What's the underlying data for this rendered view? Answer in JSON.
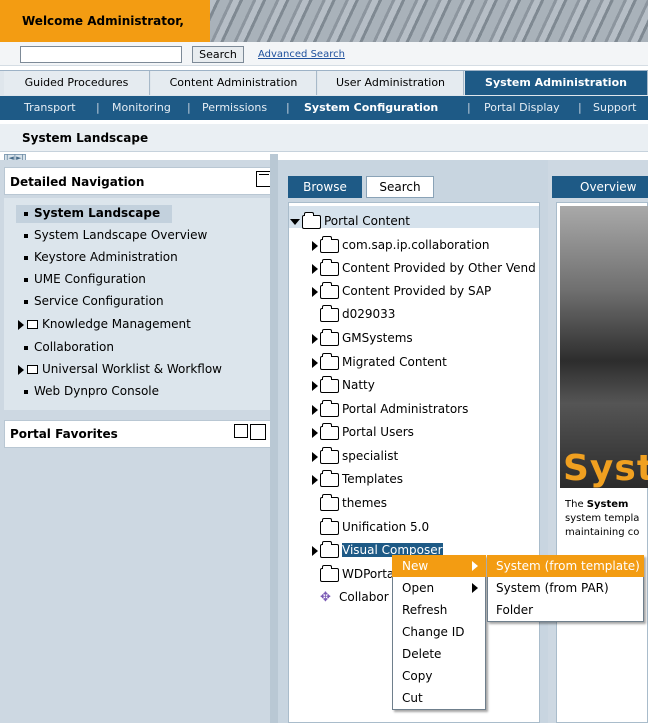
{
  "banner": {
    "welcome": "Welcome Administrator,"
  },
  "search": {
    "placeholder": "",
    "button": "Search",
    "advanced": "Advanced Search"
  },
  "top_tabs": [
    "Guided Procedures",
    "Content Administration",
    "User Administration",
    "System Administration"
  ],
  "sub_nav": [
    "Transport",
    "Monitoring",
    "Permissions",
    "System Configuration",
    "Portal Display",
    "Support"
  ],
  "page": {
    "title": "System Landscape"
  },
  "pager": "|◄|►|",
  "detailed_navigation": {
    "title": "Detailed Navigation",
    "items": [
      "System Landscape",
      "System Landscape Overview",
      "Keystore Administration",
      "UME Configuration",
      "Service Configuration",
      "Knowledge Management",
      "Collaboration",
      "Universal Worklist & Workflow",
      "Web Dynpro Console"
    ]
  },
  "portal_favorites": {
    "title": "Portal Favorites"
  },
  "browse_tabs": {
    "browse": "Browse",
    "search": "Search"
  },
  "tree": {
    "root": "Portal Content",
    "items": [
      "com.sap.ip.collaboration",
      "Content Provided by Other Vend",
      "Content Provided by SAP",
      "d029033",
      "GMSystems",
      "Migrated Content",
      "Natty",
      "Portal Administrators",
      "Portal Users",
      "specialist",
      "Templates",
      "themes",
      "Unification 5.0",
      "Visual Composer",
      "WDPortal",
      "Collabor"
    ]
  },
  "overview": {
    "tab": "Overview",
    "big_text": "Syste",
    "desc_bold": "System",
    "desc_prefix": "The ",
    "desc_line2": "system templa",
    "desc_line3": "maintaining co"
  },
  "context_menu": [
    "New",
    "Open",
    "Refresh",
    "Change ID",
    "Delete",
    "Copy",
    "Cut"
  ],
  "submenu": [
    "System (from template)",
    "System (from PAR)",
    "Folder"
  ],
  "colors": {
    "accent_orange": "#f39c12",
    "nav_blue": "#1e5a86"
  }
}
